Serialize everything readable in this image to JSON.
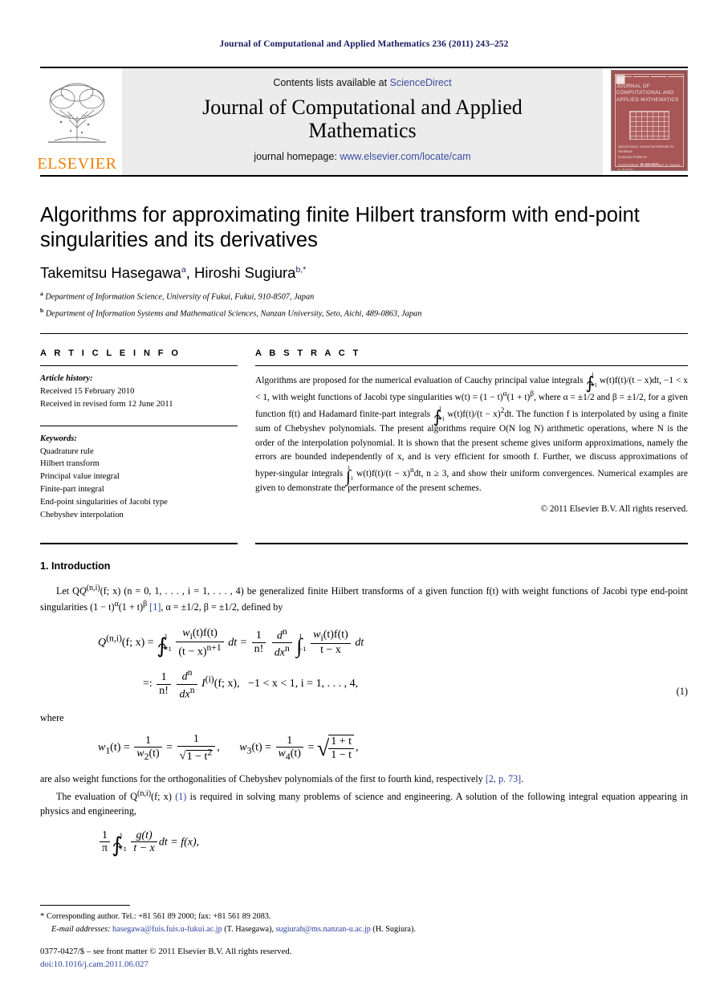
{
  "running_head": "Journal of Computational and Applied Mathematics 236 (2011) 243–252",
  "masthead": {
    "contents_prefix": "Contents lists available at ",
    "sciencedirect": "ScienceDirect",
    "journal_title_line1": "Journal of Computational and Applied",
    "journal_title_line2": "Mathematics",
    "homepage_prefix": "journal homepage: ",
    "homepage_url": "www.elsevier.com/locate/cam",
    "publisher_wordmark": "ELSEVIER",
    "publisher_color": "#f08000",
    "link_color": "#3b4fa0",
    "band_color": "#ececec",
    "cover": {
      "title": "JOURNAL OF COMPUTATIONAL AND APPLIED MATHEMATICS",
      "subtitle_line1": "Special Issue: Numerical Methods for Nonlinear",
      "subtitle_line2": "Evolution Problems",
      "subtitle_line3": "Guest Editors: M. Meerschaert, E. Suarez, A. Turchin",
      "footer": "ELSEVIER",
      "background_color": "#a85656"
    }
  },
  "article": {
    "title": "Algorithms for approximating finite Hilbert transform with end-point singularities and its derivatives",
    "author1": "Takemitsu Hasegawa",
    "author1_sup": "a",
    "author_sep": ", ",
    "author2": "Hiroshi Sugiura",
    "author2_sup": "b,",
    "author2_star": "*",
    "affiliation_a_sup": "a",
    "affiliation_a": "Department of Information Science, University of Fukui, Fukui, 910-8507, Japan",
    "affiliation_b_sup": "b",
    "affiliation_b": "Department of Information Systems and Mathematical Sciences, Nanzan University, Seto, Aichi, 489-0863, Japan"
  },
  "info": {
    "heading": "A R T I C L E    I N F O",
    "history_label": "Article history:",
    "history": [
      "Received 15 February 2010",
      "Received in revised form 12 June 2011"
    ],
    "keywords_label": "Keywords:",
    "keywords": [
      "Quadrature rule",
      "Hilbert transform",
      "Principal value integral",
      "Finite-part integral",
      "End-point singularities of Jacobi type",
      "Chebyshev interpolation"
    ]
  },
  "abstract": {
    "heading": "A B S T R A C T",
    "t1": "Algorithms are proposed for the numerical evaluation of Cauchy principal value integrals ",
    "t2": " w(t)f(t)/(t − x)dt, −1 < x < 1, with weight functions of Jacobi type singularities w(t) = (1 − t)",
    "t3": "(1 + t)",
    "t4": ", where α = ±1/2 and β = ±1/2, for a given function f(t) and Hadamard finite-part integrals ",
    "t5": " w(t)f(t)/(t − x)",
    "t6": "dt. The function f is interpolated by using a finite sum of Chebyshev polynomials. The present algorithms require O(N log N) arithmetic operations, where N is the order of the interpolation polynomial. It is shown that the present scheme gives uniform approximations, namely the errors are bounded independently of x, and is very efficient for smooth f. Further, we discuss approximations of hyper-singular integrals ",
    "t7": " w(t)f(t)/(t − x)",
    "t8": "dt, n ≥ 3, and show their uniform convergences. Numerical examples are given to demonstrate the performance of the present schemes.",
    "int_upper": "1",
    "int_lower": "−1",
    "exp_alpha": "α",
    "exp_beta": "β",
    "exp_2": "2",
    "exp_n": "n",
    "copyright": "© 2011 Elsevier B.V. All rights reserved."
  },
  "intro": {
    "heading": "1. Introduction",
    "p1_a": "Let Q",
    "p1_sup": "(n,i)",
    "p1_b": "(f; x) (n = 0, 1, . . . , i = 1, . . . , 4) be generalized finite Hilbert transforms of a given function f(t) with weight functions of Jacobi type end-point singularities (1 − t)",
    "p1_alpha": "α",
    "p1_c": "(1 + t)",
    "p1_beta": "β",
    "p1_ref1": "[1]",
    "p1_d": ", α = ±1/2, β = ±1/2, defined by",
    "eq1_number": "(1)",
    "eq1_lhs": "Q",
    "eq1_lhs_sup": "(n,i)",
    "eq1_lhs_arg": "(f; x) =",
    "eq1_num1": "w",
    "eq1_num1_sub": "i",
    "eq1_num1_rest": "(t)f(t)",
    "eq1_den1": "(t − x)",
    "eq1_den1_sup": "n+1",
    "eq1_dt": "dt =",
    "eq1_f2_num": "1",
    "eq1_f2_den": "n!",
    "eq1_f3_num": "d",
    "eq1_f3_num_sup": "n",
    "eq1_f3_den": "dx",
    "eq1_f3_den_sup": "n",
    "eq1_num2_rest": "(t)f(t)",
    "eq1_den2": "t − x",
    "eq1_dt2": "dt",
    "eq1_line2_a": "=:",
    "eq1_line2_I": "I",
    "eq1_line2_I_sup": "(i)",
    "eq1_line2_b": "(f; x),",
    "eq1_line2_c": "−1 < x < 1, i = 1, . . . , 4,",
    "int_upper": "1",
    "int_lower": "−1",
    "where": "where",
    "eq2_w1": "w",
    "eq2_w1_sub": "1",
    "eq2_w1_rest": "(t) =",
    "eq2_one": "1",
    "eq2_w2": "w",
    "eq2_w2_sub": "2",
    "eq2_w2_rest": "(t)",
    "eq2_eq": "=",
    "eq2_sqrt_body": "1 − t",
    "eq2_sqrt_sup": "2",
    "eq2_comma": ",",
    "eq2_w3": "w",
    "eq2_w3_sub": "3",
    "eq2_w3_rest": "(t) =",
    "eq2_w4": "w",
    "eq2_w4_sub": "4",
    "eq2_w4_rest": "(t)",
    "eq2_eq2": "=",
    "eq2_frac_num": "1 + t",
    "eq2_frac_den": "1 − t",
    "p2": "are also weight functions for the orthogonalities of Chebyshev polynomials of the first to fourth kind, respectively [2, p. 73].",
    "p2_ref": "[2, p. 73]",
    "p3_a": "The evaluation of Q",
    "p3_sup": "(n,i)",
    "p3_b": "(f; x) ",
    "p3_ref": "(1)",
    "p3_c": " is required in solving many problems of science and engineering. A solution of the following integral equation appearing in physics and engineering,",
    "eq3_frac_num": "1",
    "eq3_frac_den": "π",
    "eq3_gnum": "g(t)",
    "eq3_gden": "t − x",
    "eq3_tail": "dt = f(x),"
  },
  "footnotes": {
    "star": "*",
    "corresponding": "Corresponding author. Tel.: +81 561 89 2000; fax: +81 561 89 2083.",
    "email_label": "E-mail addresses:",
    "email1": "hasegawa@fuis.fuis.u-fukui.ac.jp",
    "email1_who": " (T. Hasegawa), ",
    "email2": "sugiurah@ms.nanzan-u.ac.jp",
    "email2_who": " (H. Sugiura).",
    "issn_line": "0377-0427/$ – see front matter © 2011 Elsevier B.V. All rights reserved.",
    "doi": "doi:10.1016/j.cam.2011.06.027"
  }
}
